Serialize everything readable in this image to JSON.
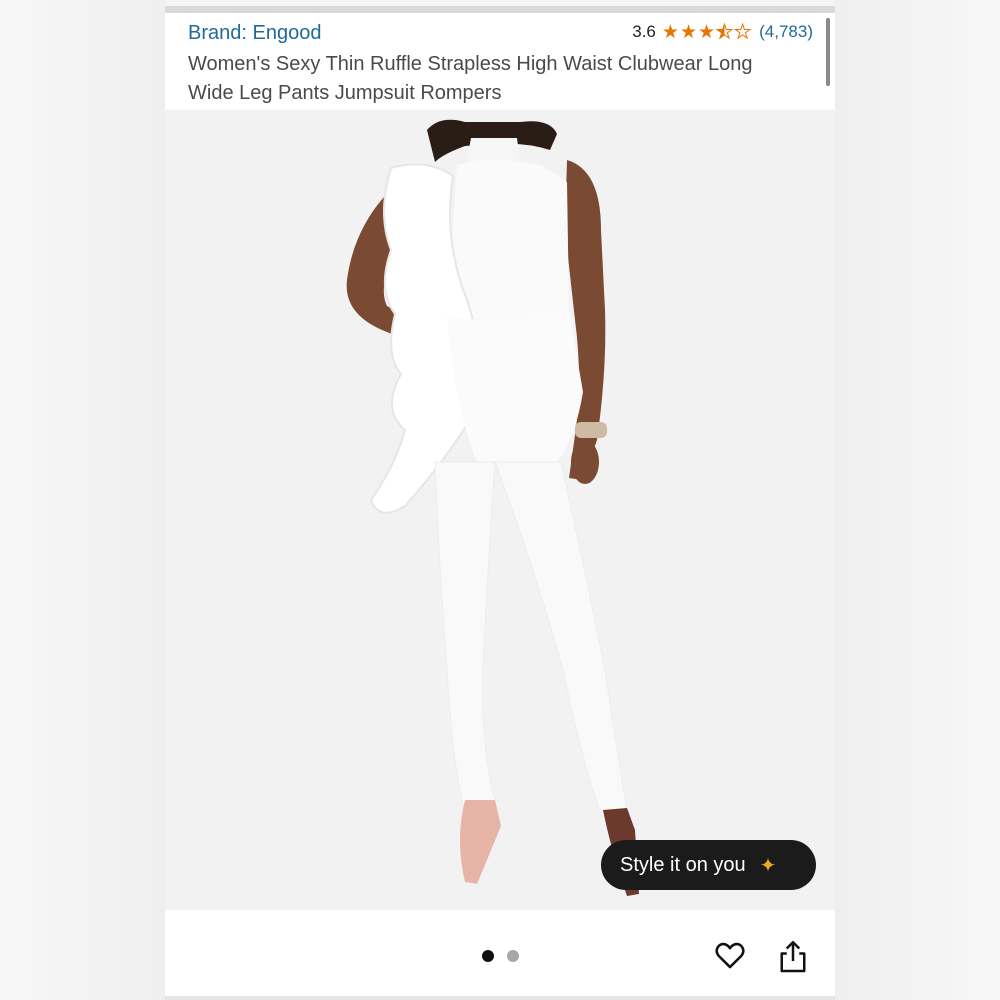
{
  "product": {
    "brand": "Brand: Engood",
    "rating_value": "3.6",
    "rating": 3.6,
    "review_count": "(4,783)",
    "title": "Women's Sexy Thin Ruffle Strapless High Waist Clubwear Long Wide Leg Pants Jumpsuit Rompers"
  },
  "image": {
    "subject": "product-photo",
    "style_button_label": "Style it on you",
    "sparkle_icon": "sparkle-icon",
    "carousel": {
      "total": 2,
      "active": 1
    }
  },
  "actions": {
    "favorite_icon": "heart-icon",
    "share_icon": "share-icon"
  },
  "colors": {
    "link": "#1f6a9a",
    "star": "#e77600",
    "pill": "#1b1b1b",
    "sparkle": "#f5a623"
  }
}
